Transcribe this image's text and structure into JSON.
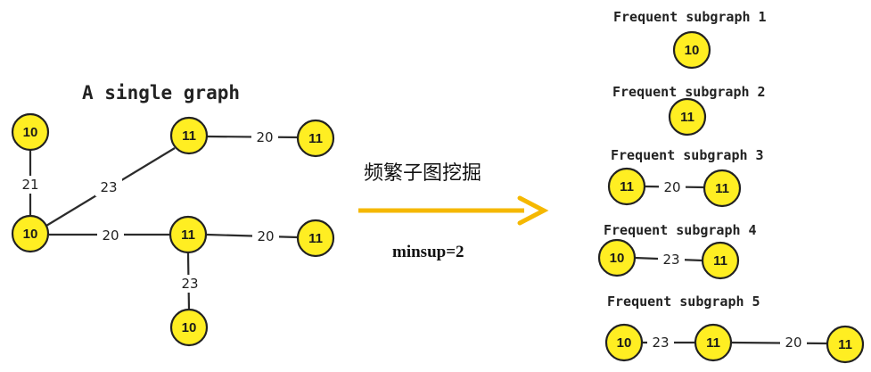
{
  "left_graph": {
    "title": "A single graph",
    "nodes": [
      {
        "id": "a",
        "label": "10"
      },
      {
        "id": "b",
        "label": "10"
      },
      {
        "id": "c",
        "label": "11"
      },
      {
        "id": "d",
        "label": "11"
      },
      {
        "id": "e",
        "label": "11"
      },
      {
        "id": "f",
        "label": "11"
      },
      {
        "id": "g",
        "label": "10"
      }
    ],
    "edges": [
      {
        "from": "a",
        "to": "b",
        "label": "21"
      },
      {
        "from": "b",
        "to": "c",
        "label": "23"
      },
      {
        "from": "c",
        "to": "d",
        "label": "20"
      },
      {
        "from": "b",
        "to": "e",
        "label": "20"
      },
      {
        "from": "e",
        "to": "f",
        "label": "20"
      },
      {
        "from": "e",
        "to": "g",
        "label": "23"
      }
    ]
  },
  "arrow": {
    "label_cn": "频繁子图挖掘",
    "minsup": "minsup=2",
    "color": "#f5b800"
  },
  "subgraphs": [
    {
      "title": "Frequent subgraph 1",
      "nodes": [
        "10"
      ],
      "edges": []
    },
    {
      "title": "Frequent subgraph 2",
      "nodes": [
        "11"
      ],
      "edges": []
    },
    {
      "title": "Frequent subgraph 3",
      "nodes": [
        "11",
        "11"
      ],
      "edges": [
        "20"
      ]
    },
    {
      "title": "Frequent subgraph 4",
      "nodes": [
        "10",
        "11"
      ],
      "edges": [
        "23"
      ]
    },
    {
      "title": "Frequent subgraph 5",
      "nodes": [
        "10",
        "11",
        "11"
      ],
      "edges": [
        "23",
        "20"
      ]
    }
  ],
  "colors": {
    "node_fill": "#ffee22",
    "node_stroke": "#222222"
  }
}
